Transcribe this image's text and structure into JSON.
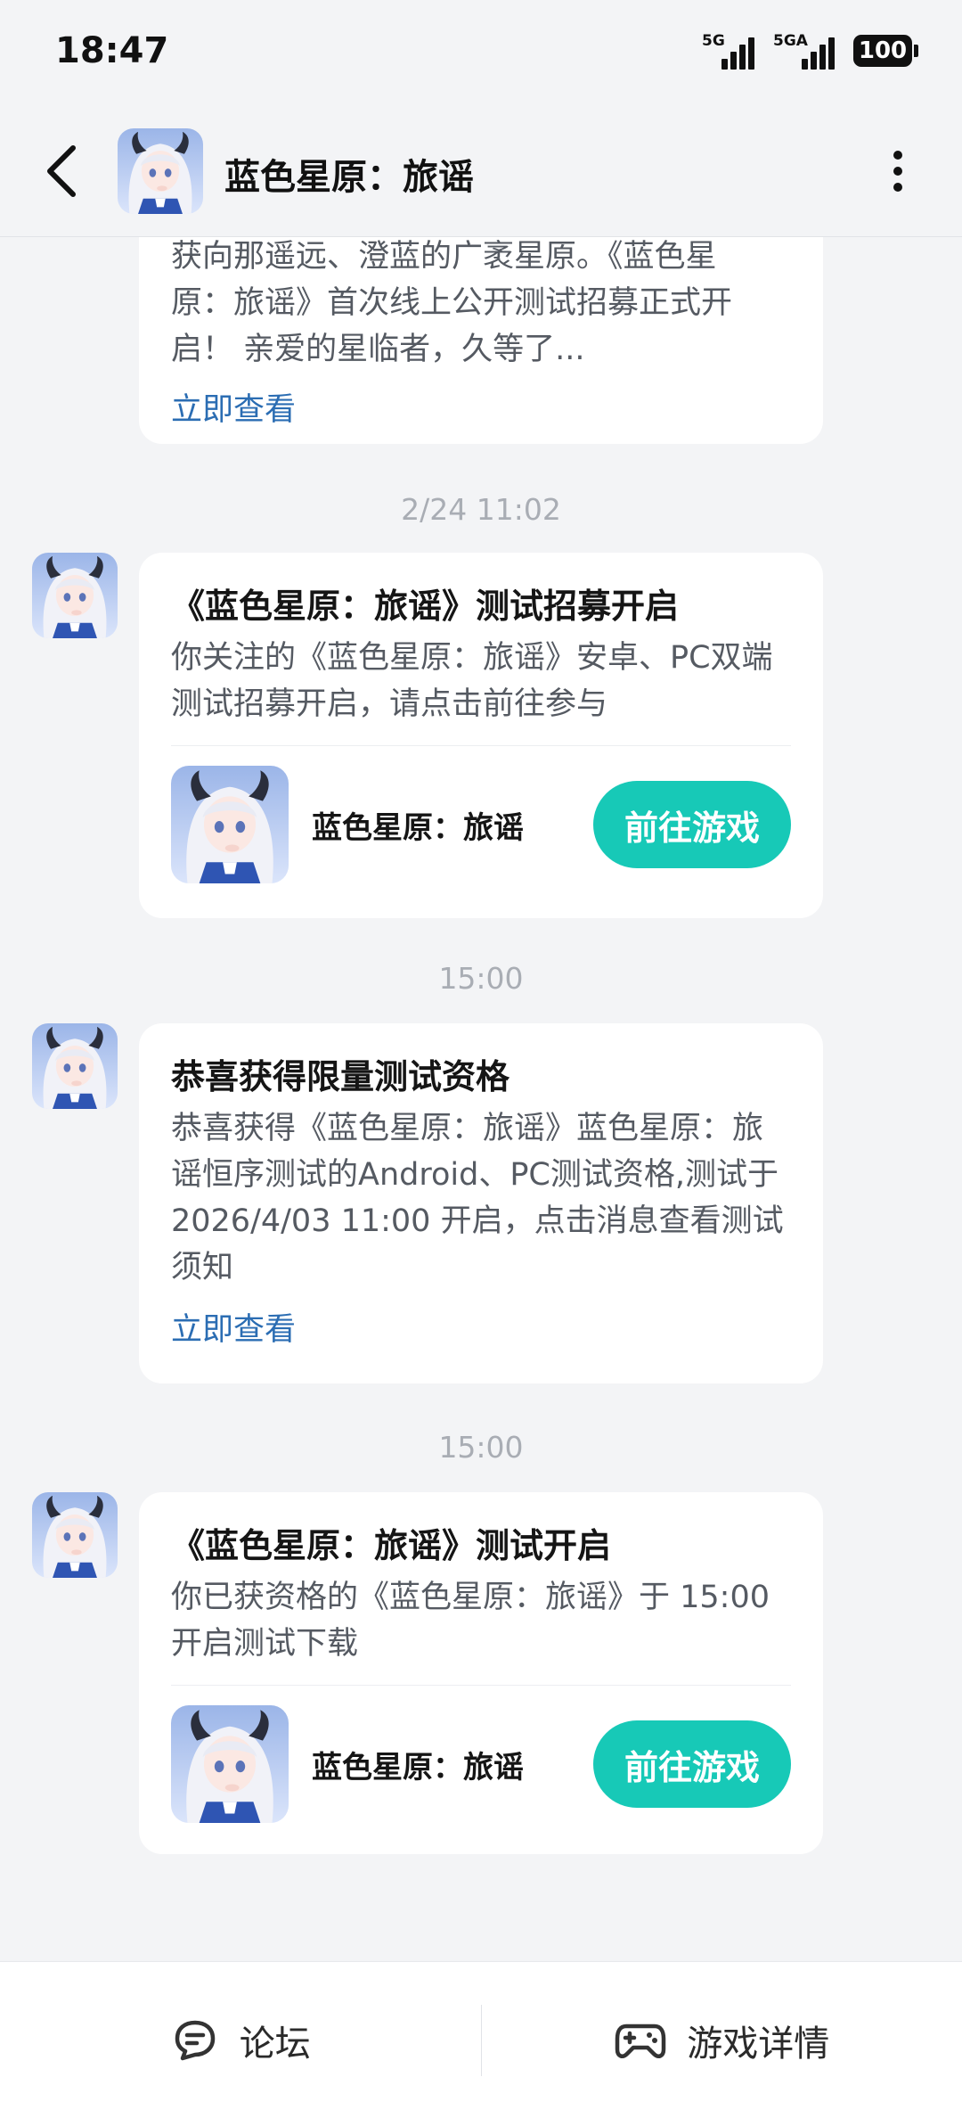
{
  "status_bar": {
    "time": "18:47",
    "signal_1": "5G",
    "signal_2": "5GA",
    "battery": "100"
  },
  "header": {
    "title": "蓝色星原：旅谣"
  },
  "messages": [
    {
      "body_lines": [
        "获向那遥远、澄蓝的广袤星原。《蓝色星",
        "原：旅谣》首次线上公开测试招募正式开",
        "启！ 亲爱的星临者，久等了..."
      ],
      "link": "立即查看"
    },
    {
      "timestamp": "2/24  11:02",
      "title": "《蓝色星原：旅谣》测试招募开启",
      "body_lines": [
        "你关注的《蓝色星原：旅谣》安卓、PC双端",
        "测试招募开启，请点击前往参与"
      ],
      "game_name": "蓝色星原：旅谣",
      "button": "前往游戏"
    },
    {
      "timestamp": "15:00",
      "title": "恭喜获得限量测试资格",
      "body_lines": [
        "恭喜获得《蓝色星原：旅谣》蓝色星原：旅",
        "谣恒序测试的Android、PC测试资格,测试于",
        "2026/4/03 11:00 开启，点击消息查看测试",
        "须知"
      ],
      "link": "立即查看"
    },
    {
      "timestamp": "15:00",
      "title": "《蓝色星原：旅谣》测试开启",
      "body_lines": [
        "你已获资格的《蓝色星原：旅谣》于 15:00",
        "开启测试下载"
      ],
      "game_name": "蓝色星原：旅谣",
      "button": "前往游戏"
    }
  ],
  "bottom_bar": {
    "forum": "论坛",
    "game_details": "游戏详情"
  },
  "colors": {
    "accent": "#17c9b7",
    "link": "#2b6db3",
    "background": "#f3f4f6"
  },
  "icons": {
    "back": "chevron-left-icon",
    "more": "more-vertical-icon",
    "forum": "chat-bubble-icon",
    "game": "gamepad-icon"
  }
}
